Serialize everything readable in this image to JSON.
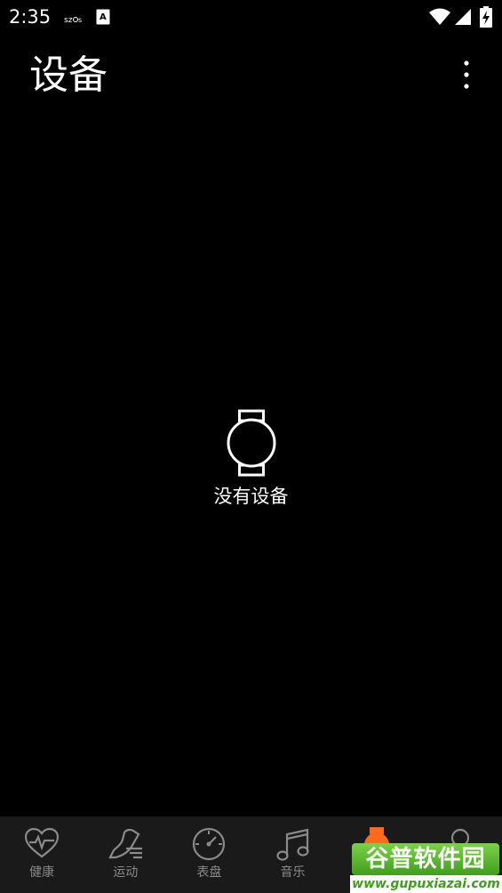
{
  "status_bar": {
    "time": "2:35",
    "icons": [
      "szos-icon",
      "a-notification-icon",
      "wifi-icon",
      "signal-icon",
      "battery-charging-icon"
    ]
  },
  "header": {
    "title": "设备",
    "menu_icon": "more-vert-icon"
  },
  "empty_state": {
    "icon": "watch-icon",
    "message": "没有设备"
  },
  "bottom_nav": {
    "items": [
      {
        "label": "健康",
        "icon": "heart-pulse-icon"
      },
      {
        "label": "运动",
        "icon": "running-shoe-icon"
      },
      {
        "label": "表盘",
        "icon": "dial-icon"
      },
      {
        "label": "音乐",
        "icon": "music-note-icon"
      },
      {
        "label": "",
        "icon": "watch-device-icon",
        "active": true
      },
      {
        "label": "",
        "icon": "profile-icon"
      }
    ],
    "active_color": "#ff6a1a",
    "inactive_color": "#8a8a8a"
  },
  "watermark": {
    "brand": "谷普软件园",
    "url": "www.gupuxiazai.com"
  }
}
